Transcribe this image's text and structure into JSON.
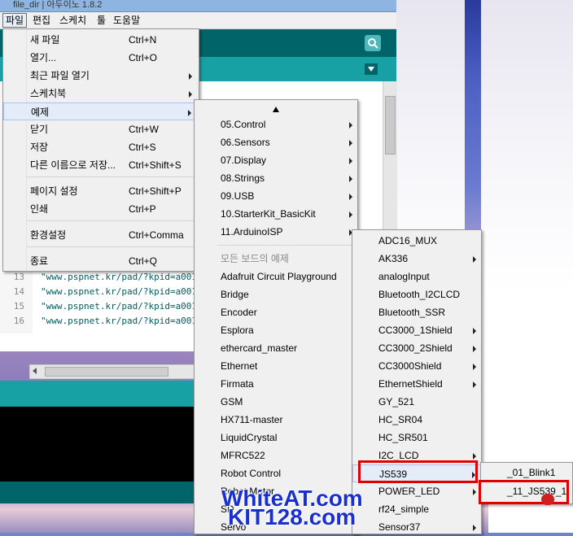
{
  "window": {
    "title": "file_dir | 아두이노 1.8.2"
  },
  "menubar": [
    {
      "label": "파일",
      "active": true
    },
    {
      "label": "편집"
    },
    {
      "label": "스케치"
    },
    {
      "label": "툴"
    },
    {
      "label": "도움말"
    }
  ],
  "file_menu": {
    "items": [
      {
        "label": "새 파일",
        "shortcut": "Ctrl+N"
      },
      {
        "label": "열기...",
        "shortcut": "Ctrl+O"
      },
      {
        "label": "최근 파일 열기",
        "submenu": true
      },
      {
        "label": "스케치북",
        "submenu": true
      },
      {
        "label": "예제",
        "submenu": true,
        "highlighted": true
      },
      {
        "label": "닫기",
        "shortcut": "Ctrl+W"
      },
      {
        "label": "저장",
        "shortcut": "Ctrl+S"
      },
      {
        "label": "다른 이름으로 저장...",
        "shortcut": "Ctrl+Shift+S"
      },
      {
        "label": "페이지 설정",
        "shortcut": "Ctrl+Shift+P"
      },
      {
        "label": "인쇄",
        "shortcut": "Ctrl+P"
      },
      {
        "label": "환경설정",
        "shortcut": "Ctrl+Comma"
      },
      {
        "label": "종료",
        "shortcut": "Ctrl+Q"
      }
    ]
  },
  "examples_menu": {
    "builtin": [
      "05.Control",
      "06.Sensors",
      "07.Display",
      "08.Strings",
      "09.USB",
      "10.StarterKit_BasicKit",
      "11.ArduinoISP"
    ],
    "section_header": "모든 보드의 예제",
    "libraries": [
      "Adafruit Circuit Playground",
      "Bridge",
      "Encoder",
      "Esplora",
      "ethercard_master",
      "Ethernet",
      "Firmata",
      "GSM",
      "HX711-master",
      "LiquidCrystal",
      "MFRC522",
      "Robot Control",
      "Robot Motor",
      "SD",
      "Servo"
    ]
  },
  "library_submenu": {
    "items": [
      {
        "label": "ADC16_MUX",
        "submenu": false
      },
      {
        "label": "AK336",
        "submenu": true
      },
      {
        "label": "analogInput",
        "submenu": false
      },
      {
        "label": "Bluetooth_I2CLCD",
        "submenu": false
      },
      {
        "label": "Bluetooth_SSR",
        "submenu": false
      },
      {
        "label": "CC3000_1Shield",
        "submenu": true
      },
      {
        "label": "CC3000_2Shield",
        "submenu": true
      },
      {
        "label": "CC3000Shield",
        "submenu": true
      },
      {
        "label": "EthernetShield",
        "submenu": true
      },
      {
        "label": "GY_521",
        "submenu": false
      },
      {
        "label": "HC_SR04",
        "submenu": false
      },
      {
        "label": "HC_SR501",
        "submenu": false
      },
      {
        "label": "I2C_LCD",
        "submenu": true
      },
      {
        "label": "JS539",
        "submenu": true,
        "highlighted": true
      },
      {
        "label": "POWER_LED",
        "submenu": true
      },
      {
        "label": "rf24_simple",
        "submenu": false
      },
      {
        "label": "Sensor37",
        "submenu": true
      }
    ]
  },
  "js539_submenu": {
    "items": [
      "_01_Blink1",
      "_11_JS539_1"
    ]
  },
  "editor": {
    "lines": [
      {
        "num": "13",
        "text": "\"www.pspnet.kr/pad/?kpid=a001&k"
      },
      {
        "num": "14",
        "text": "\"www.pspnet.kr/pad/?kpid=a001&k"
      },
      {
        "num": "15",
        "text": "\"www.pspnet.kr/pad/?kpid=a001&k"
      },
      {
        "num": "16",
        "text": "\"www.pspnet.kr/pad/?kpid=a001&k"
      }
    ]
  },
  "watermark": {
    "line1": "WhiteAT.com",
    "line2": "KIT128.com"
  },
  "colors": {
    "teal_dark": "#006468",
    "teal_light": "#17a1a5",
    "highlight_box": "#e00000",
    "watermark": "#1a2fd0"
  }
}
